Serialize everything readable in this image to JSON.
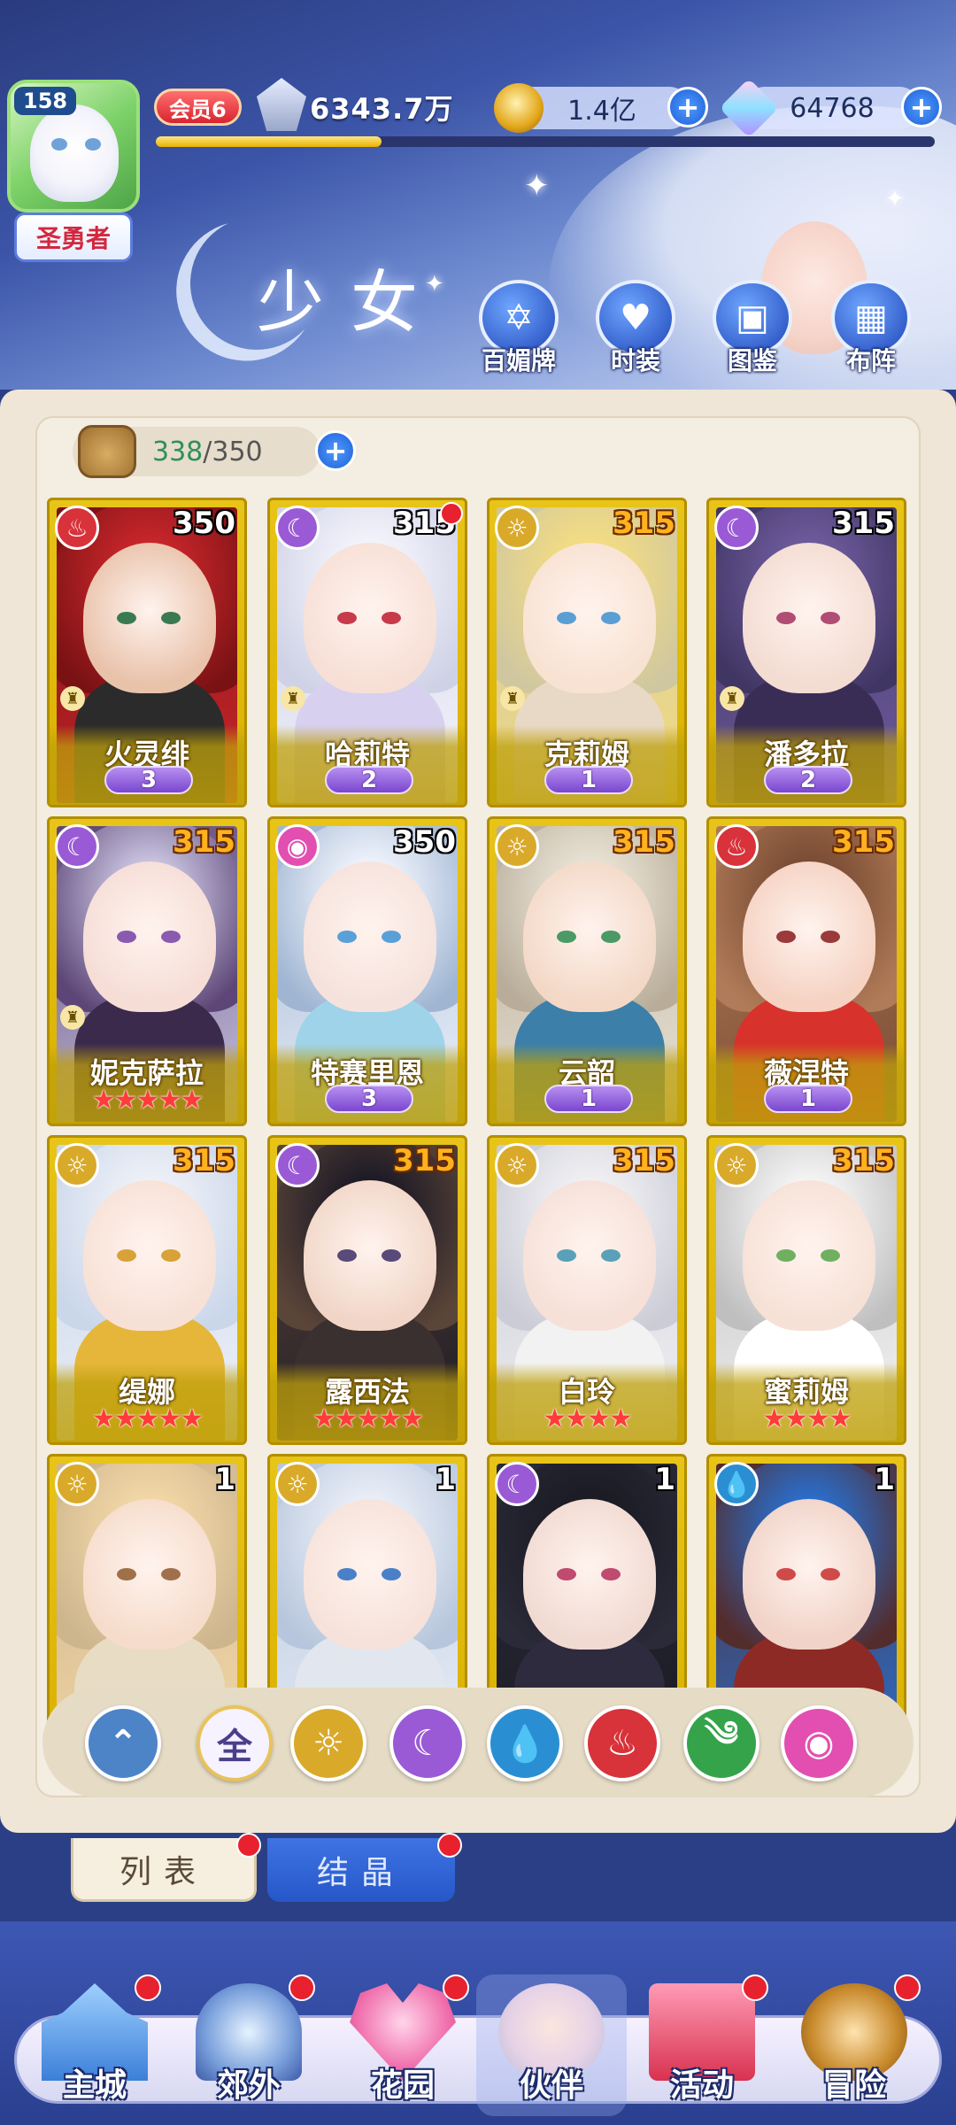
{
  "player": {
    "level": "158",
    "title_badge": "圣勇者",
    "vip": "会员6",
    "power": "6343.7万",
    "xp_fraction": 0.29,
    "gold": "1.4亿",
    "gems": "64768"
  },
  "page_heading": "少女",
  "top_nav": [
    {
      "label": "百媚牌",
      "icon": "card-deck-icon"
    },
    {
      "label": "时装",
      "icon": "costume-icon"
    },
    {
      "label": "图鉴",
      "icon": "book-icon"
    },
    {
      "label": "布阵",
      "icon": "grid-formation-icon"
    }
  ],
  "capacity": {
    "current": "338",
    "max": "/350"
  },
  "heroes": [
    {
      "name": "火灵绯",
      "level": "350",
      "element": "fire",
      "rank_type": "wings",
      "rank": "3",
      "level_style": "white",
      "red_dot": false,
      "rook": true
    },
    {
      "name": "哈莉特",
      "level": "315",
      "element": "moon",
      "rank_type": "wings",
      "rank": "2",
      "level_style": "white",
      "red_dot": true,
      "rook": true
    },
    {
      "name": "克莉姆",
      "level": "315",
      "element": "sun",
      "rank_type": "wings",
      "rank": "1",
      "level_style": "orange",
      "red_dot": false,
      "rook": true
    },
    {
      "name": "潘多拉",
      "level": "315",
      "element": "moon",
      "rank_type": "wings",
      "rank": "2",
      "level_style": "white",
      "red_dot": false,
      "rook": true
    },
    {
      "name": "妮克萨拉",
      "level": "315",
      "element": "moon",
      "rank_type": "stars",
      "rank": "5",
      "level_style": "orange",
      "red_dot": false,
      "rook": true
    },
    {
      "name": "特赛里恩",
      "level": "350",
      "element": "pink",
      "rank_type": "wings",
      "rank": "3",
      "level_style": "white",
      "red_dot": false,
      "rook": false
    },
    {
      "name": "云韶",
      "level": "315",
      "element": "sun",
      "rank_type": "wings",
      "rank": "1",
      "level_style": "orange",
      "red_dot": false,
      "rook": false
    },
    {
      "name": "薇涅特",
      "level": "315",
      "element": "fire",
      "rank_type": "wings",
      "rank": "1",
      "level_style": "orange",
      "red_dot": false,
      "rook": false
    },
    {
      "name": "缇娜",
      "level": "315",
      "element": "sun",
      "rank_type": "stars",
      "rank": "5",
      "level_style": "orange",
      "red_dot": false,
      "rook": false
    },
    {
      "name": "露西法",
      "level": "315",
      "element": "moon",
      "rank_type": "stars",
      "rank": "5",
      "level_style": "orange",
      "red_dot": false,
      "rook": false
    },
    {
      "name": "白玲",
      "level": "315",
      "element": "sun",
      "rank_type": "stars",
      "rank": "4",
      "level_style": "orange",
      "red_dot": false,
      "rook": false
    },
    {
      "name": "蜜莉姆",
      "level": "315",
      "element": "sun",
      "rank_type": "stars",
      "rank": "4",
      "level_style": "orange",
      "red_dot": false,
      "rook": false
    },
    {
      "name": "",
      "level": "1",
      "element": "sun",
      "rank_type": "none",
      "rank": "",
      "level_style": "white",
      "red_dot": false,
      "rook": false
    },
    {
      "name": "",
      "level": "1",
      "element": "sun",
      "rank_type": "none",
      "rank": "",
      "level_style": "white",
      "red_dot": false,
      "rook": false
    },
    {
      "name": "",
      "level": "1",
      "element": "moon",
      "rank_type": "none",
      "rank": "",
      "level_style": "white",
      "red_dot": false,
      "rook": false
    },
    {
      "name": "",
      "level": "1",
      "element": "water",
      "rank_type": "none",
      "rank": "",
      "level_style": "white",
      "red_dot": false,
      "rook": false
    }
  ],
  "filters": [
    {
      "id": "collapse",
      "label": "",
      "icon": "collapse-up-icon",
      "color": "#4d84c8"
    },
    {
      "id": "all",
      "label": "全",
      "icon": "all-icon",
      "color": "#f6f2ff"
    },
    {
      "id": "sun",
      "label": "",
      "icon": "sun-icon",
      "color": "#d9a92a"
    },
    {
      "id": "moon",
      "label": "",
      "icon": "moon-icon",
      "color": "#9a5ad6"
    },
    {
      "id": "water",
      "label": "",
      "icon": "water-drop-icon",
      "color": "#2a8fd2"
    },
    {
      "id": "fire",
      "label": "",
      "icon": "fire-icon",
      "color": "#d8323a"
    },
    {
      "id": "wind",
      "label": "",
      "icon": "wind-icon",
      "color": "#34a34a"
    },
    {
      "id": "pink",
      "label": "",
      "icon": "charm-icon",
      "color": "#e24fb0"
    }
  ],
  "tabs": {
    "list": "列表",
    "crystal": "结晶"
  },
  "bottom_nav": [
    {
      "label": "主城",
      "icon": "castle-icon"
    },
    {
      "label": "郊外",
      "icon": "portal-icon"
    },
    {
      "label": "花园",
      "icon": "heart-garden-icon"
    },
    {
      "label": "伙伴",
      "icon": "partner-portrait-icon"
    },
    {
      "label": "活动",
      "icon": "gift-box-icon"
    },
    {
      "label": "冒险",
      "icon": "compass-icon"
    }
  ],
  "colors": {
    "fire": "#d8323a",
    "moon": "#9a5ad6",
    "sun": "#d9a92a",
    "water": "#2a8fd2",
    "pink": "#e24fb0",
    "card_gold": "#e0bb12",
    "accent_blue": "#2657c8"
  }
}
